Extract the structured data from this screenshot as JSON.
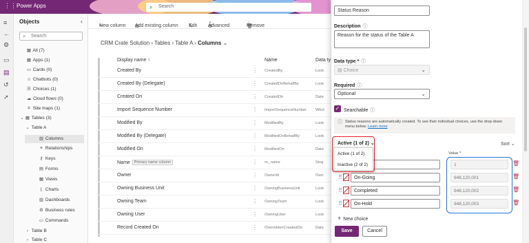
{
  "app": {
    "title": "Power Apps",
    "search_placeholder": "Search"
  },
  "objects": {
    "header": "Objects",
    "search_placeholder": "Search",
    "items": [
      {
        "label": "All (7)",
        "icon": "all-icon"
      },
      {
        "label": "Apps (1)",
        "icon": "apps-icon"
      },
      {
        "label": "Cards (0)",
        "icon": "cards-icon"
      },
      {
        "label": "Chatbots (0)",
        "icon": "chatbot-icon"
      },
      {
        "label": "Choices (1)",
        "icon": "choices-icon"
      },
      {
        "label": "Cloud flows (0)",
        "icon": "cloud-flow-icon"
      },
      {
        "label": "Site maps (1)",
        "icon": "site-map-icon"
      },
      {
        "label": "Tables (3)",
        "icon": "table-icon"
      },
      {
        "label": "Table A",
        "icon": "chevron-down-icon"
      },
      {
        "label": "Columns",
        "icon": "columns-icon"
      },
      {
        "label": "Relationships",
        "icon": "relationships-icon"
      },
      {
        "label": "Keys",
        "icon": "key-icon"
      },
      {
        "label": "Forms",
        "icon": "form-icon"
      },
      {
        "label": "Views",
        "icon": "view-icon"
      },
      {
        "label": "Charts",
        "icon": "chart-icon"
      },
      {
        "label": "Dashboards",
        "icon": "dashboard-icon"
      },
      {
        "label": "Business rules",
        "icon": "business-rule-icon"
      },
      {
        "label": "Commands",
        "icon": "command-icon"
      },
      {
        "label": "Table B",
        "icon": "chevron-right-icon"
      },
      {
        "label": "Table C",
        "icon": "chevron-right-icon"
      }
    ]
  },
  "toolbar": {
    "new_column": "New column",
    "add_existing": "Add existing column",
    "edit": "Edit",
    "advanced": "Advanced",
    "remove": "Remove"
  },
  "breadcrumb": {
    "solution": "CRM Crate Solution",
    "tables": "Tables",
    "table": "Table A",
    "current": "Columns"
  },
  "table": {
    "headers": {
      "display": "Display name ↑",
      "name": "Name",
      "data": "Data ty"
    },
    "rows": [
      {
        "display": "Created By",
        "name": "CreatedBy",
        "type": "Look"
      },
      {
        "display": "Created By (Delegate)",
        "name": "CreatedOnBehalfBy",
        "type": "Look"
      },
      {
        "display": "Created On",
        "name": "CreatedOn",
        "type": "Date"
      },
      {
        "display": "Import Sequence Number",
        "name": "ImportSequenceNumber",
        "type": "Whol"
      },
      {
        "display": "Modified By",
        "name": "ModifiedBy",
        "type": "Look"
      },
      {
        "display": "Modified By (Delegate)",
        "name": "ModifiedOnBehalfBy",
        "type": "Look"
      },
      {
        "display": "Modified On",
        "name": "ModifiedOn",
        "type": "Date"
      },
      {
        "display": "Name",
        "badge": "Primary name column",
        "name": "cc_name",
        "type": "Sing"
      },
      {
        "display": "Owner",
        "name": "OwnerId",
        "type": "Own"
      },
      {
        "display": "Owning Business Unit",
        "name": "OwningBusinessUnit",
        "type": "Look"
      },
      {
        "display": "Owning Team",
        "name": "OwningTeam",
        "type": "Look"
      },
      {
        "display": "Owning User",
        "name": "OwningUser",
        "type": "Look"
      },
      {
        "display": "Record Created On",
        "name": "OverriddenCreatedOn",
        "type": "Date"
      }
    ]
  },
  "panel": {
    "display_name_value": "Status Reason",
    "description_label": "Description",
    "description_value": "Reason for the status of the Table A",
    "data_type_label": "Data type *",
    "data_type_value": "Choice",
    "required_label": "Required",
    "required_value": "Optional",
    "searchable_label": "Searchable",
    "info_text": "Status reasons are automatically created. To see their individual choices, use the drop-down menu below.",
    "info_link": "Learn more",
    "status_select": "Active (1 of 2)",
    "sort_label": "Sort",
    "dropdown_options": [
      "Active (1 of 2)",
      "Inactive (2 of 2)"
    ],
    "value_header": "Value *",
    "choices": [
      {
        "label": "",
        "value": "1"
      },
      {
        "label": "On-Going",
        "value": "948,120,001"
      },
      {
        "label": "Completed",
        "value": "948,120,002"
      },
      {
        "label": "On-Hold",
        "value": "948,120,003"
      }
    ],
    "new_choice": "New choice",
    "save": "Save",
    "cancel": "Cancel",
    "accent_color": "#742774"
  }
}
